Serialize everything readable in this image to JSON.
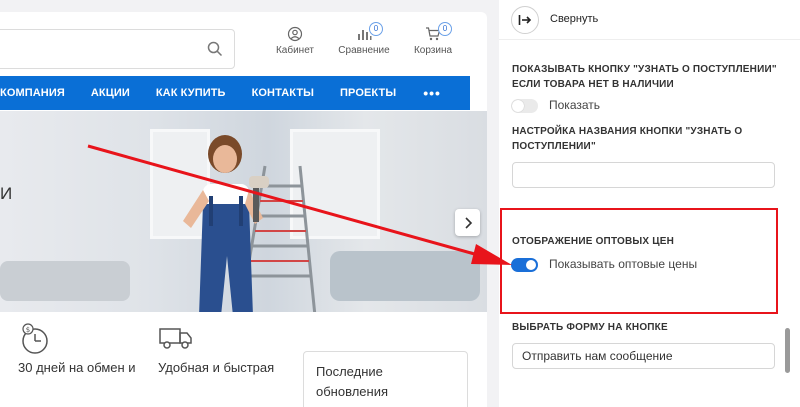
{
  "header": {
    "search": {
      "placeholder": ""
    },
    "cabinet_label": "Кабинет",
    "compare_label": "Сравнение",
    "compare_count": "0",
    "cart_label": "Корзина",
    "cart_count": "0"
  },
  "nav": {
    "items": [
      "КОМПАНИЯ",
      "АКЦИИ",
      "КАК КУПИТЬ",
      "КОНТАКТЫ",
      "ПРОЕКТЫ"
    ],
    "more": "•••"
  },
  "banner": {
    "partial_text": "И"
  },
  "features": {
    "item1": "30 дней на обмен и",
    "item2": "Удобная и быстрая",
    "updates_line1": "Последние",
    "updates_line2": "обновления"
  },
  "panel": {
    "collapse_label": "Свернуть",
    "notify_section_label": "ПОКАЗЫВАТЬ КНОПКУ \"УЗНАТЬ О ПОСТУПЛЕНИИ\" ЕСЛИ ТОВАРА НЕТ В НАЛИЧИИ",
    "notify_toggle_label": "Показать",
    "notify_toggle_on": false,
    "button_name_label": "НАСТРОЙКА НАЗВАНИЯ КНОПКИ \"УЗНАТЬ О ПОСТУПЛЕНИИ\"",
    "button_name_value": "",
    "wholesale_section_label": "ОТОБРАЖЕНИЕ ОПТОВЫХ ЦЕН",
    "wholesale_toggle_label": "Показывать оптовые цены",
    "wholesale_toggle_on": true,
    "form_section_label": "ВЫБРАТЬ ФОРМУ НА КНОПКЕ",
    "form_value": "Отправить нам сообщение"
  },
  "colors": {
    "accent": "#0a6fd6",
    "toggle_on": "#1a6fd8",
    "annotation": "#e8141b"
  }
}
